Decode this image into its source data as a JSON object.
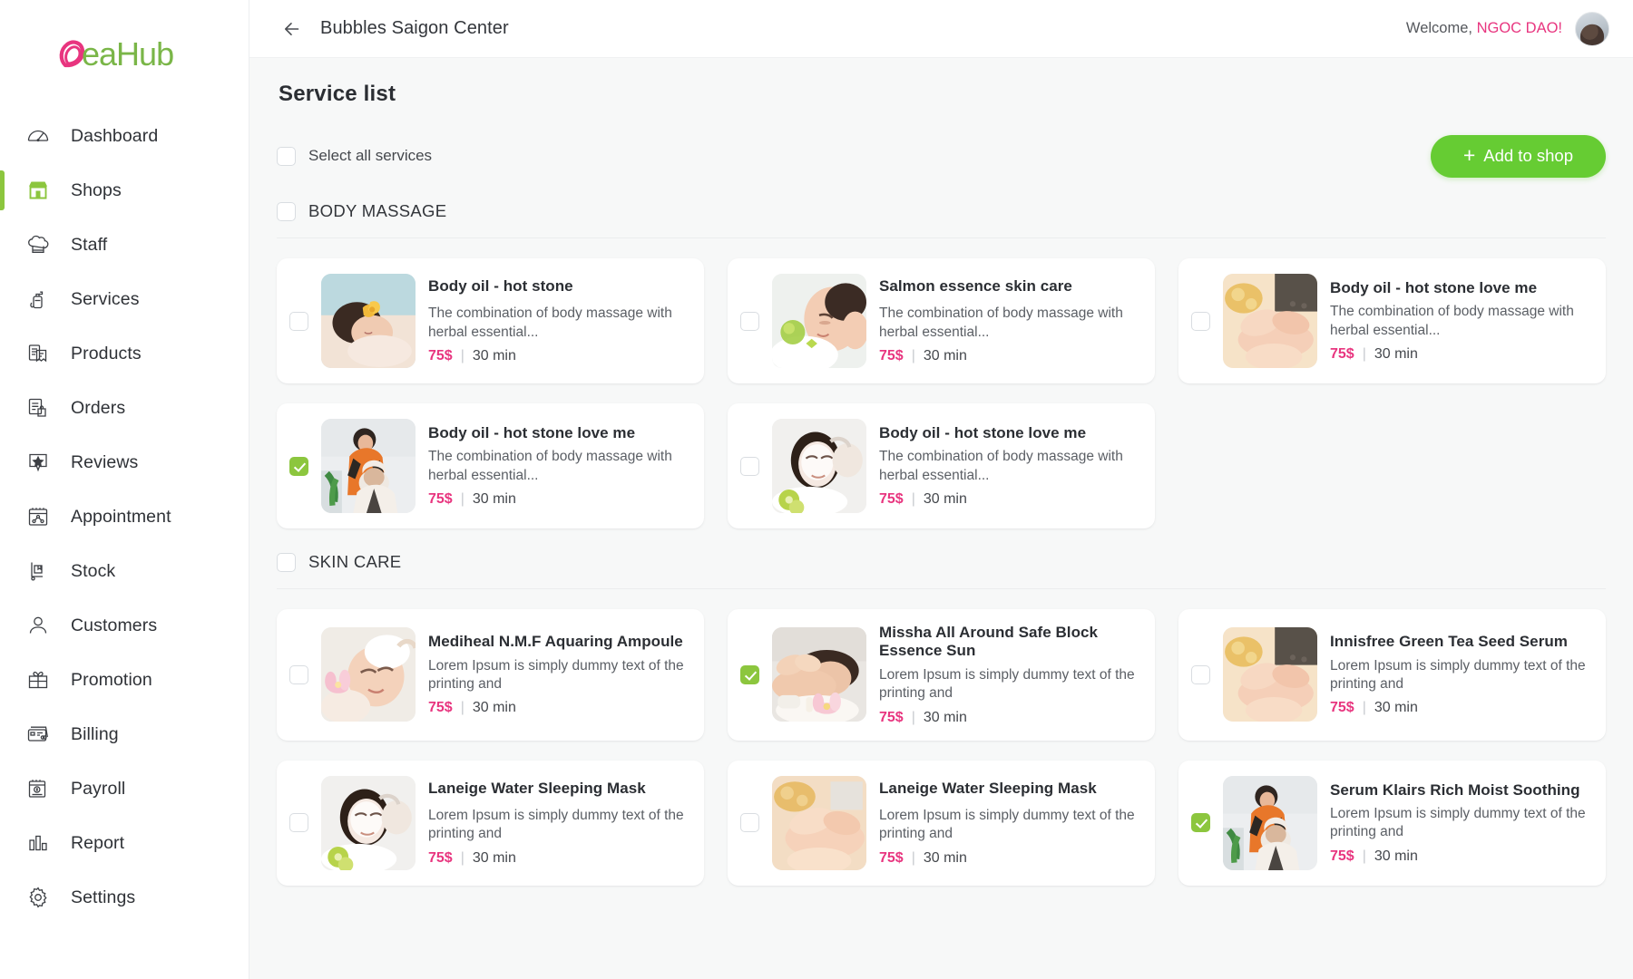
{
  "brand": {
    "name": "BeaHub",
    "name_part_1": "Bea",
    "name_part_2": "Hub",
    "accent_pink": "#e8357f",
    "accent_green": "#8cc63e",
    "button_green": "#66cc33"
  },
  "sidebar": {
    "items": [
      {
        "label": "Dashboard",
        "icon": "speedometer-icon",
        "active": false
      },
      {
        "label": "Shops",
        "icon": "store-icon",
        "active": true
      },
      {
        "label": "Staff",
        "icon": "chef-hat-icon",
        "active": false
      },
      {
        "label": "Services",
        "icon": "lotion-bottle-icon",
        "active": false
      },
      {
        "label": "Products",
        "icon": "documents-icon",
        "active": false
      },
      {
        "label": "Orders",
        "icon": "clipboard-bag-icon",
        "active": false
      },
      {
        "label": "Reviews",
        "icon": "star-badge-icon",
        "active": false
      },
      {
        "label": "Appointment",
        "icon": "calendar-people-icon",
        "active": false
      },
      {
        "label": "Stock",
        "icon": "hand-truck-icon",
        "active": false
      },
      {
        "label": "Customers",
        "icon": "person-icon",
        "active": false
      },
      {
        "label": "Promotion",
        "icon": "gift-icon",
        "active": false
      },
      {
        "label": "Billing",
        "icon": "credit-card-icon",
        "active": false
      },
      {
        "label": "Payroll",
        "icon": "payroll-calendar-icon",
        "active": false
      },
      {
        "label": "Report",
        "icon": "bar-chart-icon",
        "active": false
      },
      {
        "label": "Settings",
        "icon": "gear-icon",
        "active": false
      }
    ]
  },
  "topbar": {
    "back_icon": "arrow-left-icon",
    "title": "Bubbles Saigon Center",
    "welcome_prefix": "Welcome, ",
    "user_name": "NGOC DAO!",
    "avatar_icon": "user-avatar"
  },
  "page": {
    "title": "Service  list",
    "select_all_label": "Select all services",
    "select_all_checked": false,
    "add_button_label": "Add to shop",
    "add_button_icon": "plus-icon"
  },
  "groups": [
    {
      "name": "BODY MASSAGE",
      "checked": false,
      "services": [
        {
          "title": "Body oil - hot stone",
          "description": "The combination of body massage with herbal essential...",
          "price": "75$",
          "duration": "30 min",
          "separator": "|",
          "checked": false,
          "image": "woman-massage-orchid"
        },
        {
          "title": "Salmon essence skin care",
          "description": "The combination of body massage with herbal essential...",
          "price": "75$",
          "duration": "30 min",
          "separator": "|",
          "checked": false,
          "image": "woman-facial-green"
        },
        {
          "title": "Body oil - hot stone love me",
          "description": "The combination of body massage with herbal essential...",
          "price": "75$",
          "duration": "30 min",
          "separator": "|",
          "checked": false,
          "image": "foot-massage-oil"
        },
        {
          "title": "Body oil - hot stone love me",
          "description": "The combination of body massage with herbal essential...",
          "price": "75$",
          "duration": "30 min",
          "separator": "|",
          "checked": true,
          "image": "therapist-orange-towel"
        },
        {
          "title": "Body oil - hot stone love me",
          "description": "The combination of body massage with herbal essential...",
          "price": "75$",
          "duration": "30 min",
          "separator": "|",
          "checked": false,
          "image": "facial-mask-white"
        }
      ]
    },
    {
      "name": "SKIN CARE",
      "checked": false,
      "services": [
        {
          "title": "Mediheal N.M.F Aquaring Ampoule",
          "description": "Lorem Ipsum is simply dummy text of the printing and",
          "price": "75$",
          "duration": "30 min",
          "separator": "|",
          "checked": false,
          "image": "facial-flower-pink"
        },
        {
          "title": "Missha All Around Safe Block Essence Sun",
          "description": "Lorem Ipsum is simply dummy text of the printing and",
          "price": "75$",
          "duration": "30 min",
          "separator": "|",
          "checked": true,
          "image": "back-massage-flower"
        },
        {
          "title": "Innisfree Green Tea Seed Serum",
          "description": "Lorem Ipsum is simply dummy text of the printing and",
          "price": "75$",
          "duration": "30 min",
          "separator": "|",
          "checked": false,
          "image": "foot-massage-oil"
        },
        {
          "title": "Laneige Water Sleeping Mask",
          "description": "Lorem Ipsum is simply dummy text of the printing and",
          "price": "75$",
          "duration": "30 min",
          "separator": "|",
          "checked": false,
          "image": "facial-mask-white"
        },
        {
          "title": "Laneige Water Sleeping Mask",
          "description": "Lorem Ipsum is simply dummy text of the printing and",
          "price": "75$",
          "duration": "30 min",
          "separator": "|",
          "checked": false,
          "image": "hand-massage-warm"
        },
        {
          "title": "Serum Klairs Rich Moist Soothing",
          "description": "Lorem Ipsum is simply dummy text of the printing and",
          "price": "75$",
          "duration": "30 min",
          "separator": "|",
          "checked": true,
          "image": "therapist-orange-towel"
        }
      ]
    }
  ]
}
